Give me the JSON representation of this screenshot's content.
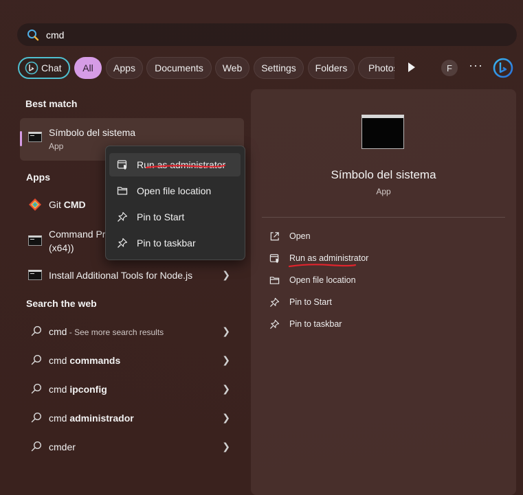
{
  "search": {
    "query": "cmd"
  },
  "filters": {
    "chat": "Chat",
    "all": "All",
    "apps": "Apps",
    "documents": "Documents",
    "web": "Web",
    "settings": "Settings",
    "folders": "Folders",
    "photos": "Photos",
    "account_initial": "F",
    "more": "···"
  },
  "best_match": {
    "title": "Best match",
    "name": "Símbolo del sistema",
    "type": "App"
  },
  "apps_section": {
    "title": "Apps",
    "items": [
      {
        "prefix": "Git ",
        "bold": "CMD"
      },
      {
        "line1": "Command Pr",
        "line2": "(x64))"
      },
      {
        "label": "Install Additional Tools for Node.js"
      }
    ]
  },
  "web_section": {
    "title": "Search the web",
    "items": [
      {
        "prefix": "cmd",
        "suffix": " - See more search results"
      },
      {
        "prefix": "cmd ",
        "bold": "commands"
      },
      {
        "prefix": "cmd ",
        "bold": "ipconfig"
      },
      {
        "prefix": "cmd ",
        "bold": "administrador"
      },
      {
        "prefix": "cmder",
        "bold": ""
      }
    ]
  },
  "context_menu": [
    {
      "label": "Run as administrator",
      "icon": "shield-app-icon"
    },
    {
      "label": "Open file location",
      "icon": "folder-icon"
    },
    {
      "label": "Pin to Start",
      "icon": "pin-icon"
    },
    {
      "label": "Pin to taskbar",
      "icon": "pin-icon"
    }
  ],
  "preview": {
    "name": "Símbolo del sistema",
    "type": "App",
    "actions": [
      {
        "label": "Open",
        "icon": "open-external-icon"
      },
      {
        "label": "Run as administrator",
        "icon": "shield-app-icon"
      },
      {
        "label": "Open file location",
        "icon": "folder-icon"
      },
      {
        "label": "Pin to Start",
        "icon": "pin-icon"
      },
      {
        "label": "Pin to taskbar",
        "icon": "pin-icon"
      }
    ]
  },
  "colors": {
    "accent": "#d69ce6",
    "chat_border": "#4fc0d0",
    "annotation": "#e0242d"
  }
}
